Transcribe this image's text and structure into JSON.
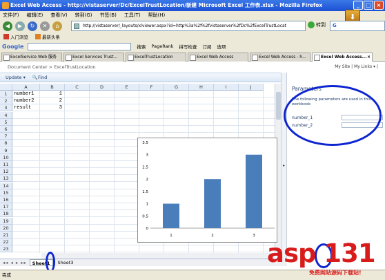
{
  "window": {
    "title": "Excel Web Access - http://vistaserver/Dc/ExcelTrustLocation/新建 Microsoft Excel 工作表.xlsx - Mozilla Firefox"
  },
  "menu": [
    "文件(F)",
    "编辑(E)",
    "查看(V)",
    "转到(G)",
    "书签(B)",
    "工具(T)",
    "帮助(H)"
  ],
  "nav": {
    "url": "http://vistaserver/_layouts/xlviewer.aspx?id=http%3a%2f%2fvistaserver%2fDc%2fExcelTrustLocat",
    "go_label": "转到",
    "search_prefix": "G"
  },
  "bookmarks": [
    "入门浏览",
    "最新头条"
  ],
  "google_toolbar": {
    "logo": "Google",
    "items": [
      "搜索",
      "PageRank",
      "拼写检查",
      "订阅",
      "选项"
    ]
  },
  "tabs": [
    {
      "label": "ExcelService Web 服务"
    },
    {
      "label": "Excel Services Trust..."
    },
    {
      "label": "ExcelTrustLocation"
    },
    {
      "label": "Excel Web Access"
    },
    {
      "label": "Excel Web Access - h..."
    },
    {
      "label": "Excel Web Access..."
    }
  ],
  "page": {
    "breadcrumb": "Document Center > ExcelTrustLocation",
    "mysite": "My Site",
    "mylinks": "My Links"
  },
  "ribbon": {
    "update": "Update",
    "find": "Find"
  },
  "sheet": {
    "columns": [
      "A",
      "B",
      "C",
      "D",
      "E",
      "F",
      "G",
      "H",
      "I",
      "J"
    ],
    "rows": [
      "1",
      "2",
      "3",
      "4",
      "5",
      "6",
      "7",
      "8",
      "9",
      "10",
      "11",
      "12",
      "13",
      "14",
      "15",
      "16",
      "17",
      "18",
      "19",
      "20",
      "21",
      "22",
      "23"
    ],
    "cells": [
      {
        "r": 0,
        "c": 0,
        "v": "number1"
      },
      {
        "r": 0,
        "c": 1,
        "v": "1"
      },
      {
        "r": 1,
        "c": 0,
        "v": "number2"
      },
      {
        "r": 1,
        "c": 1,
        "v": "2"
      },
      {
        "r": 2,
        "c": 0,
        "v": "result"
      },
      {
        "r": 2,
        "c": 1,
        "v": "3"
      }
    ],
    "tabs": [
      "Sheet1",
      "Sheet3"
    ],
    "nav_arrows": "◂◂ ◂ ▸ ▸▸"
  },
  "chart_data": {
    "type": "bar",
    "categories": [
      "1",
      "2",
      "3"
    ],
    "values": [
      1,
      2,
      3
    ],
    "ylim": [
      0,
      3.5
    ],
    "yticks": [
      0,
      0.5,
      1,
      1.5,
      2,
      2.5,
      3,
      3.5
    ],
    "color": "#4a7ebb",
    "grid": false
  },
  "params": {
    "title": "Parameters",
    "desc": "The following parameters are used in this workbook:",
    "fields": [
      {
        "label": "number_1",
        "value": ""
      },
      {
        "label": "number_2",
        "value": ""
      }
    ]
  },
  "status": "完成",
  "watermark": {
    "main": "asp 131",
    "sub": "免费网站源码下载站!"
  }
}
